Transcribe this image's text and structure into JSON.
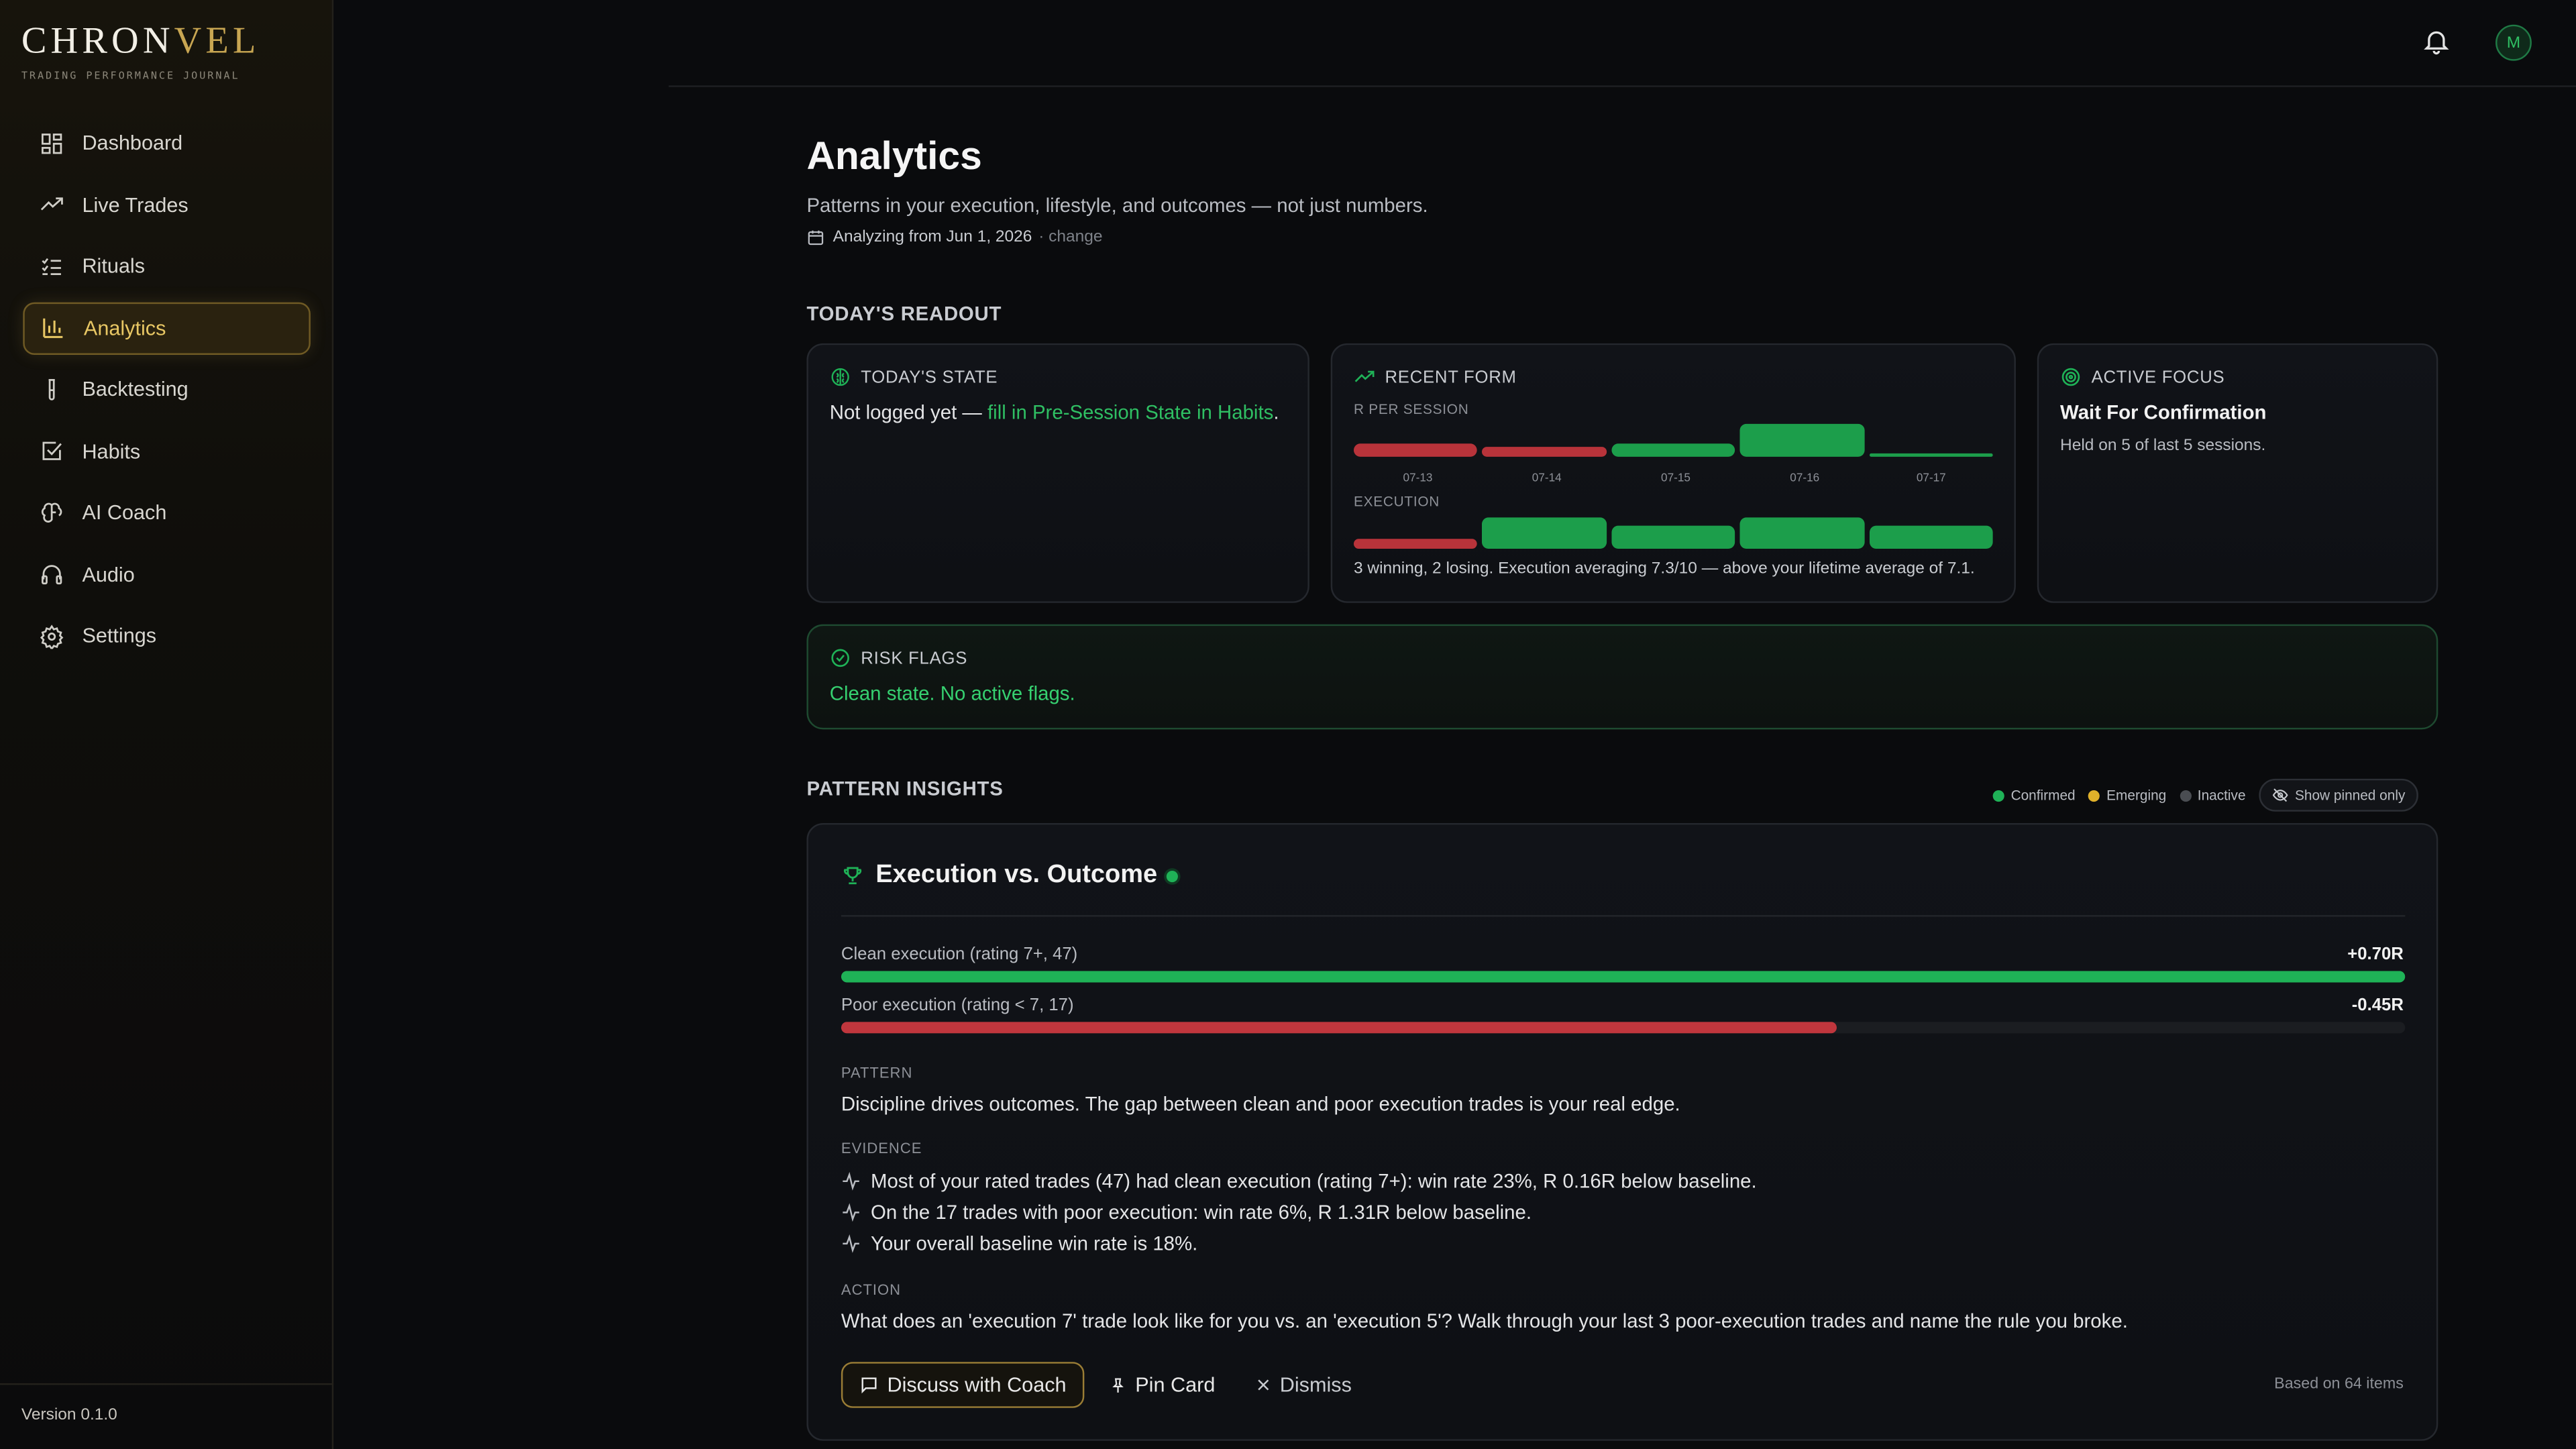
{
  "brand": {
    "name_a": "CHRON",
    "name_b": "VEL",
    "tagline": "TRADING PERFORMANCE JOURNAL"
  },
  "nav": [
    {
      "label": "Dashboard",
      "icon": "dashboard-icon"
    },
    {
      "label": "Live Trades",
      "icon": "trending-up-icon"
    },
    {
      "label": "Rituals",
      "icon": "checklist-icon"
    },
    {
      "label": "Analytics",
      "icon": "bar-chart-icon",
      "active": true
    },
    {
      "label": "Backtesting",
      "icon": "test-tube-icon"
    },
    {
      "label": "Habits",
      "icon": "check-square-icon"
    },
    {
      "label": "AI Coach",
      "icon": "brain-icon"
    },
    {
      "label": "Audio",
      "icon": "headphones-icon"
    },
    {
      "label": "Settings",
      "icon": "gear-icon"
    }
  ],
  "version": "Version 0.1.0",
  "user": {
    "initial": "M"
  },
  "page": {
    "title": "Analytics",
    "subtitle": "Patterns in your execution, lifestyle, and outcomes — not just numbers.",
    "analyzing": "Analyzing from Jun 1, 2026",
    "change": "· change"
  },
  "readout": {
    "heading": "TODAY'S READOUT",
    "state": {
      "title": "TODAY'S STATE",
      "text_a": "Not logged yet — ",
      "link": "fill in Pre-Session State in Habits",
      "text_b": "."
    },
    "form": {
      "title": "RECENT FORM",
      "r_label": "R PER SESSION",
      "exec_label": "EXECUTION",
      "sessions": [
        "07-13",
        "07-14",
        "07-15",
        "07-16",
        "07-17"
      ],
      "summary": "3 winning, 2 losing. Execution averaging 7.3/10 — above your lifetime average of 7.1."
    },
    "focus": {
      "title": "ACTIVE FOCUS",
      "name": "Wait For Confirmation",
      "note": "Held on 5 of last 5 sessions."
    }
  },
  "flags": {
    "title": "RISK FLAGS",
    "text": "Clean state. No active flags."
  },
  "insights": {
    "heading": "PATTERN INSIGHTS",
    "legend": {
      "confirmed": "Confirmed",
      "emerging": "Emerging",
      "inactive": "Inactive",
      "pinned": "Show pinned only"
    },
    "colors": {
      "confirmed": "#1fb257",
      "emerging": "#e0b12a",
      "inactive": "#4a4d52"
    },
    "card": {
      "title": "Execution vs. Outcome",
      "clean_label": "Clean execution (rating 7+, 47)",
      "clean_value": "+0.70R",
      "clean_fill": 1.0,
      "poor_label": "Poor execution (rating < 7, 17)",
      "poor_value": "-0.45R",
      "poor_fill": 0.637,
      "pattern_label": "PATTERN",
      "pattern": "Discipline drives outcomes. The gap between clean and poor execution trades is your real edge.",
      "evidence_label": "EVIDENCE",
      "evidence": [
        "Most of your rated trades (47) had clean execution (rating 7+): win rate 23%, R 0.16R below baseline.",
        "On the 17 trades with poor execution: win rate 6%, R 1.31R below baseline.",
        "Your overall baseline win rate is 18%."
      ],
      "action_label": "ACTION",
      "action": "What does an 'execution 7' trade look like for you vs. an 'execution 5'? Walk through your last 3 poor-execution trades and name the rule you broke.",
      "buttons": {
        "coach": "Discuss with Coach",
        "pin": "Pin Card",
        "dismiss": "Dismiss"
      },
      "based_on": "Based on 64 items"
    }
  }
}
